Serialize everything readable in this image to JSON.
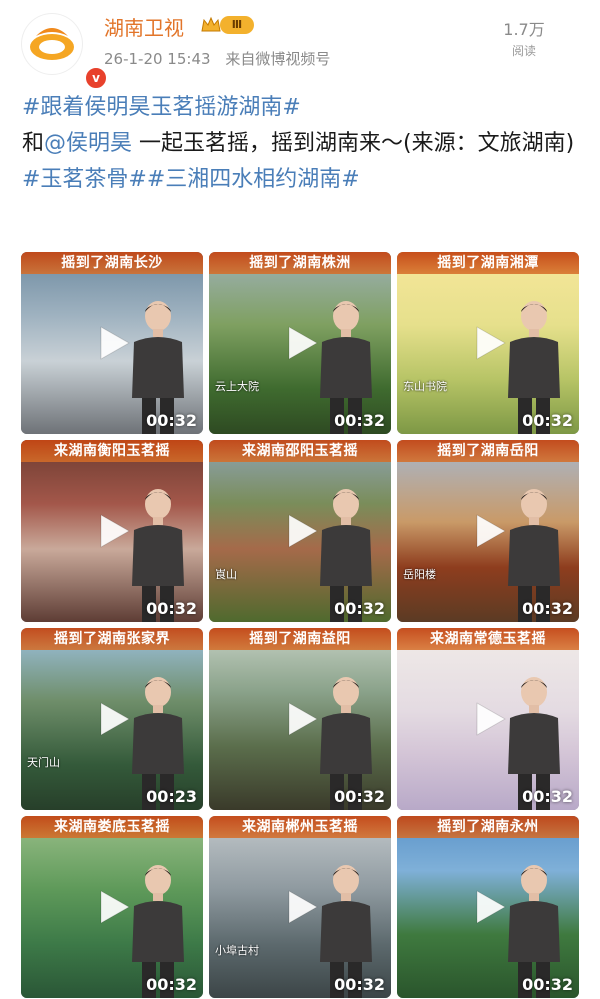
{
  "account": {
    "name": "湖南卫视",
    "level": "Ⅲ",
    "timestamp": "26-1-20 15:43",
    "source": "来自微博视频号",
    "reads_count": "1.7万",
    "reads_label": "阅读"
  },
  "post": {
    "tag1": "#跟着侯明昊玉茗摇游湖南#",
    "line2_prefix": "和",
    "mention": "@侯明昊",
    "line2_rest": " 一起玉茗摇，摇到湖南来～(来源：文旅湖南)",
    "tag2": "#玉茗茶骨#",
    "tag3": "#三湘四水相约湖南#"
  },
  "videos": [
    {
      "caption": "摇到了湖南长沙",
      "duration": "00:32",
      "place": ""
    },
    {
      "caption": "摇到了湖南株洲",
      "duration": "00:32",
      "place": "云上大院"
    },
    {
      "caption": "摇到了湖南湘潭",
      "duration": "00:32",
      "place": "东山书院"
    },
    {
      "caption": "来湖南衡阳玉茗摇",
      "duration": "00:32",
      "place": ""
    },
    {
      "caption": "来湖南邵阳玉茗摇",
      "duration": "00:32",
      "place": "崀山"
    },
    {
      "caption": "摇到了湖南岳阳",
      "duration": "00:32",
      "place": "岳阳楼"
    },
    {
      "caption": "摇到了湖南张家界",
      "duration": "00:23",
      "place": "天门山"
    },
    {
      "caption": "摇到了湖南益阳",
      "duration": "00:32",
      "place": ""
    },
    {
      "caption": "来湖南常德玉茗摇",
      "duration": "00:32",
      "place": ""
    },
    {
      "caption": "来湖南娄底玉茗摇",
      "duration": "00:32",
      "place": ""
    },
    {
      "caption": "来湖南郴州玉茗摇",
      "duration": "00:32",
      "place": "小埠古村"
    },
    {
      "caption": "摇到了湖南永州",
      "duration": "00:32",
      "place": ""
    }
  ],
  "icons": {
    "play": "play-icon",
    "crown": "crown-icon",
    "verified": "verified-icon"
  },
  "colors": {
    "account_name": "#e2752a",
    "tag": "#4a7eb8",
    "level_badge": "#f3b12d",
    "verified": "#e8412c",
    "caption_bg": "#c44614"
  }
}
